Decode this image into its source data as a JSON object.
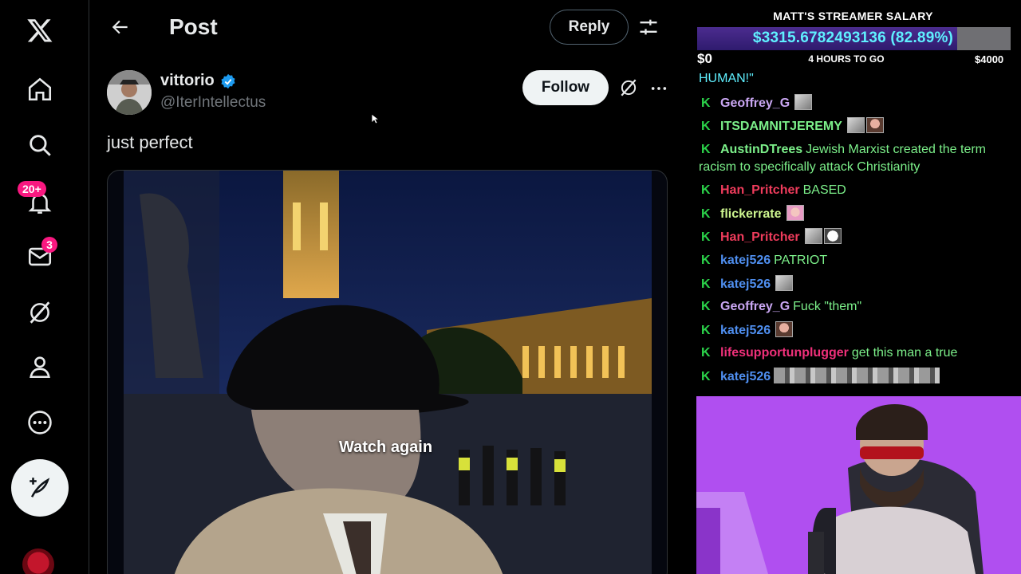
{
  "nav": {
    "notifications_badge": "20+",
    "messages_badge": "3"
  },
  "header": {
    "title": "Post",
    "reply_label": "Reply"
  },
  "post": {
    "author_name": "vittorio",
    "author_handle": "@IterIntellectus",
    "follow_label": "Follow",
    "text": "just perfect",
    "video_overlay": "Watch again"
  },
  "overlay": {
    "salary_title": "MATT'S STREAMER SALARY",
    "salary_amount": "$3315.6782493136 (82.89%)",
    "salary_progress": 0.8289,
    "min_label": "$0",
    "time_label": "4 HOURS TO GO",
    "max_label": "$4000",
    "chat": [
      {
        "user": "",
        "message": "HUMAN!\"",
        "color": "#5ff0ff",
        "badge": false
      },
      {
        "user": "Geoffrey_G",
        "message": "",
        "color": "#c9a6f2",
        "badge": true
      },
      {
        "user": "ITSDAMNITJEREMY",
        "message": "",
        "color": "#7cf08a",
        "badge": true
      },
      {
        "user": "AustinDTrees",
        "message": "Jewish Marxist created the term racism to specifically attack Christianity",
        "color": "#7cf08a",
        "badge": true
      },
      {
        "user": "Han_Pritcher",
        "message": "BASED",
        "color": "#ef3c5c",
        "badge": true
      },
      {
        "user": "flickerrate",
        "message": "",
        "color": "#cdf58f",
        "badge": true
      },
      {
        "user": "Han_Pritcher",
        "message": "",
        "color": "#ef3c5c",
        "badge": true
      },
      {
        "user": "katej526",
        "message": "PATRIOT",
        "color": "#4f8ff0",
        "badge": true
      },
      {
        "user": "katej526",
        "message": "",
        "color": "#4f8ff0",
        "badge": true
      },
      {
        "user": "Geoffrey_G",
        "message": "Fuck \"them\"",
        "color": "#c9a6f2",
        "badge": true
      },
      {
        "user": "katej526",
        "message": "",
        "color": "#4f8ff0",
        "badge": true
      },
      {
        "user": "lifesupportunplugger",
        "message": "get this man a true",
        "color": "#f0307a",
        "badge": true
      },
      {
        "user": "katej526",
        "message": "",
        "color": "#4f8ff0",
        "badge": true
      }
    ]
  },
  "colors": {
    "accent_blue": "#1d9bf0",
    "badge_pink": "#f91880",
    "kick_green": "#2bd34a"
  }
}
